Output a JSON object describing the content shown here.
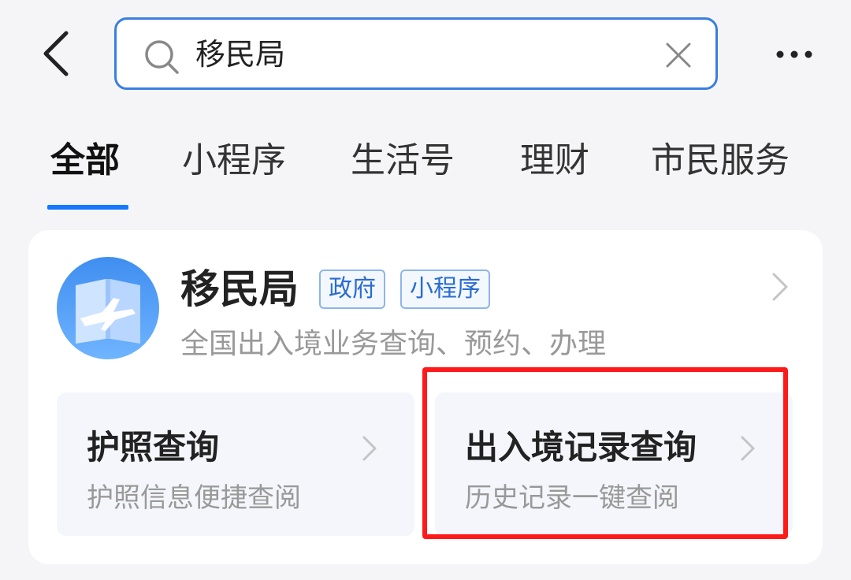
{
  "header": {
    "back_icon": "chevron-left-icon",
    "search": {
      "value": "移民局",
      "search_icon": "search-icon",
      "clear_icon": "close-icon"
    },
    "more_icon": "more-dots-icon"
  },
  "tabs": [
    {
      "label": "全部",
      "active": true
    },
    {
      "label": "小程序",
      "active": false
    },
    {
      "label": "生活号",
      "active": false
    },
    {
      "label": "理财",
      "active": false
    },
    {
      "label": "市民服务",
      "active": false
    }
  ],
  "result": {
    "logo_icon": "airplane-book-icon",
    "name": "移民局",
    "tags": [
      "政府",
      "小程序"
    ],
    "description": "全国出入境业务查询、预约、办理",
    "services": [
      {
        "title": "护照查询",
        "subtitle": "护照信息便捷查阅"
      },
      {
        "title": "出入境记录查询",
        "subtitle": "历史记录一键查阅"
      }
    ]
  },
  "colors": {
    "accent": "#1677ff",
    "search_border": "#3a7ee0",
    "highlight": "#ff1a1a",
    "tag_text": "#2a6cd2"
  }
}
